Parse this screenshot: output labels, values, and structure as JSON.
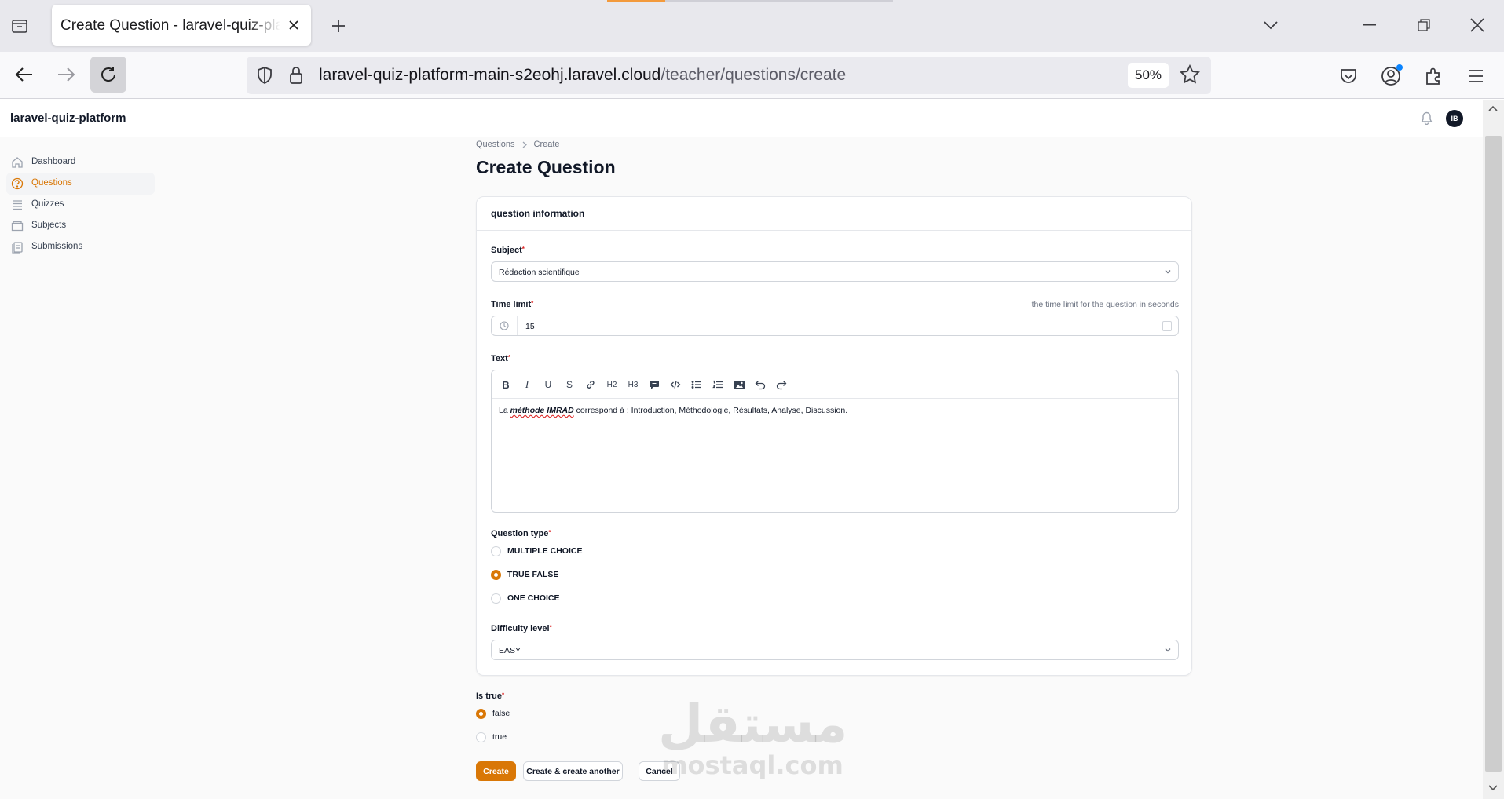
{
  "browser": {
    "tab_title": "Create Question - laravel-quiz-platform",
    "url_host": "laravel-quiz-platform-main-s2eohj.laravel.cloud",
    "url_path": "/teacher/questions/create",
    "zoom": "50%"
  },
  "app": {
    "brand": "laravel-quiz-platform",
    "avatar_initials": "IB"
  },
  "sidebar": {
    "items": [
      {
        "label": "Dashboard",
        "icon": "home-icon",
        "active": false
      },
      {
        "label": "Questions",
        "icon": "question-circle-icon",
        "active": true
      },
      {
        "label": "Quizzes",
        "icon": "list-icon",
        "active": false
      },
      {
        "label": "Subjects",
        "icon": "folder-icon",
        "active": false
      },
      {
        "label": "Submissions",
        "icon": "clipboard-icon",
        "active": false
      }
    ]
  },
  "breadcrumb": [
    "Questions",
    "Create"
  ],
  "page_title": "Create Question",
  "form": {
    "section_title": "question information",
    "subject": {
      "label": "Subject",
      "value": "Rédaction scientifique"
    },
    "time_limit": {
      "label": "Time limit",
      "hint": "the time limit for the question in seconds",
      "value": "15"
    },
    "text": {
      "label": "Text",
      "content_pre": "La ",
      "content_em": "méthode IMRAD",
      "content_post": " correspond à : Introduction, Méthodologie, Résultats, Analyse, Discussion."
    },
    "toolbar_icons": [
      "bold-icon",
      "italic-icon",
      "underline-icon",
      "strike-icon",
      "link-icon",
      "h2-icon",
      "h3-icon",
      "blockquote-icon",
      "code-block-icon",
      "bullet-list-icon",
      "ordered-list-icon",
      "image-icon",
      "undo-icon",
      "redo-icon"
    ],
    "toolbar_text": {
      "h2": "H2",
      "h3": "H3"
    },
    "question_type": {
      "label": "Question type",
      "options": [
        "MULTIPLE CHOICE",
        "TRUE FALSE",
        "ONE CHOICE"
      ],
      "selected": "TRUE FALSE"
    },
    "difficulty": {
      "label": "Difficulty level",
      "value": "EASY"
    },
    "is_true": {
      "label": "Is true",
      "options": [
        "false",
        "true"
      ],
      "selected": "false"
    }
  },
  "actions": {
    "create": "Create",
    "create_another": "Create & create another",
    "cancel": "Cancel"
  },
  "watermark": {
    "arabic": "مستقل",
    "latin": "mostaql.com"
  },
  "colors": {
    "accent": "#d97706",
    "required": "#dc2626",
    "progress": "#f39a3c"
  }
}
